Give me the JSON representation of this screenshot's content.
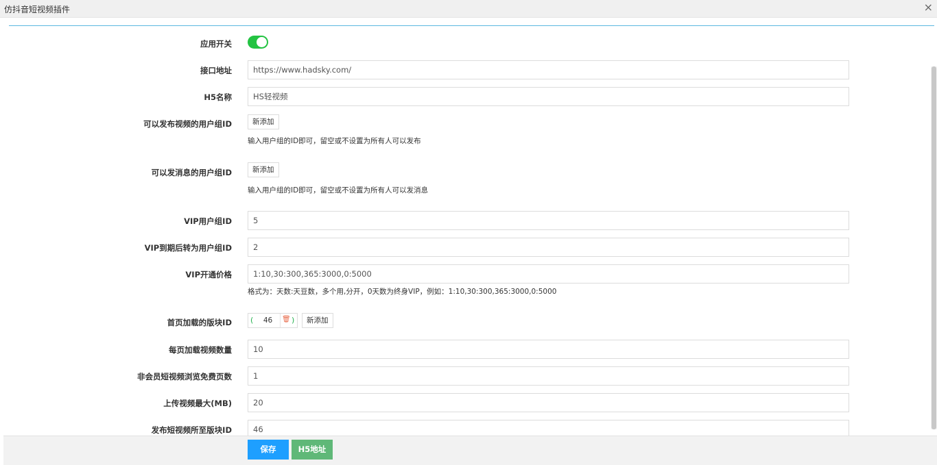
{
  "window": {
    "title": "仿抖音短视频插件",
    "close_icon": "×"
  },
  "form": {
    "switch": {
      "label": "应用开关",
      "on": true,
      "on_color": "#23c342"
    },
    "api_url": {
      "label": "接口地址",
      "value": "https://www.hadsky.com/"
    },
    "h5_name": {
      "label": "H5名称",
      "value": "HS轻视频"
    },
    "video_groups": {
      "label": "可以发布视频的用户组ID",
      "add_label": "新添加",
      "hint": "输入用户组的ID即可，留空或不设置为所有人可以发布"
    },
    "message_groups": {
      "label": "可以发消息的用户组ID",
      "add_label": "新添加",
      "hint": "输入用户组的ID即可，留空或不设置为所有人可以发消息"
    },
    "vip_group": {
      "label": "VIP用户组ID",
      "value": "5"
    },
    "vip_expire_group": {
      "label": "VIP到期后转为用户组ID",
      "value": "2"
    },
    "vip_price": {
      "label": "VIP开通价格",
      "value": "1:10,30:300,365:3000,0:5000",
      "hint": "格式为：天数:天豆数，多个用,分开，0天数为终身VIP，例如：1:10,30:300,365:3000,0:5000"
    },
    "home_board": {
      "label": "首页加载的版块ID",
      "tag_open": "(",
      "tag_value": "46",
      "tag_close": ")",
      "add_label": "新添加"
    },
    "per_page": {
      "label": "每页加载视频数量",
      "value": "10"
    },
    "free_pages": {
      "label": "非会员短视频浏览免费页数",
      "value": "1"
    },
    "max_upload": {
      "label": "上传视频最大(MB)",
      "value": "20"
    },
    "publish_board": {
      "label": "发布短视频所至版块ID",
      "value": "46"
    }
  },
  "footer": {
    "save_label": "保存",
    "h5_label": "H5地址"
  },
  "colors": {
    "primary": "#1e9fff",
    "success": "#5fb878",
    "divider": "#5ab7e0"
  }
}
